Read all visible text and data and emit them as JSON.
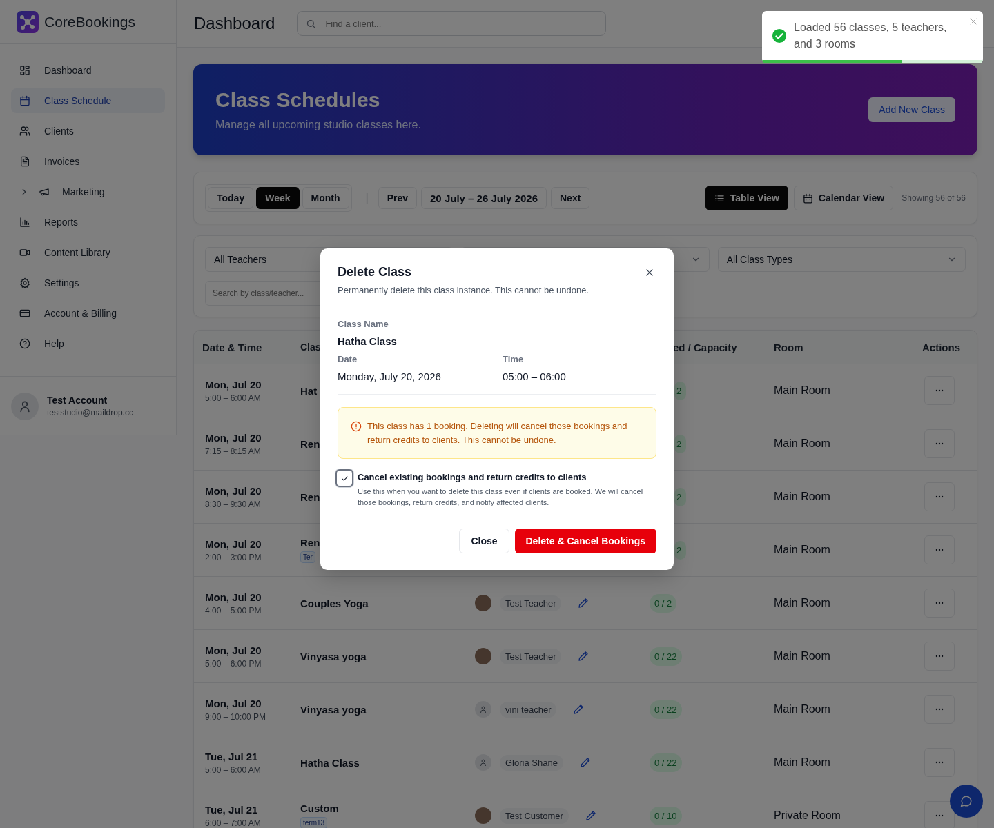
{
  "sidebar": {
    "brand": "CoreBookings",
    "items": [
      {
        "label": "Dashboard",
        "kind": "link",
        "selected": false
      },
      {
        "label": "Class Schedule",
        "kind": "link",
        "selected": true
      },
      {
        "label": "Clients",
        "kind": "link",
        "selected": false
      },
      {
        "label": "Invoices",
        "kind": "link",
        "selected": false
      },
      {
        "label": "Marketing",
        "kind": "group",
        "selected": false,
        "expanded": false
      },
      {
        "label": "Reports",
        "kind": "link",
        "selected": false
      },
      {
        "label": "Content Library",
        "kind": "link",
        "selected": false
      },
      {
        "label": "Settings",
        "kind": "link",
        "selected": false
      },
      {
        "label": "Account & Billing",
        "kind": "link",
        "selected": false
      },
      {
        "label": "Help",
        "kind": "link",
        "selected": false
      }
    ],
    "user": {
      "name": "Test Account",
      "email": "teststudio@maildrop.cc"
    }
  },
  "header": {
    "title": "Dashboard",
    "search": {
      "placeholder": "Find a client..."
    }
  },
  "toast": {
    "message": "Loaded 56 classes, 5 teachers, and 3 rooms",
    "level": 0.63
  },
  "banner": {
    "title": "Class Schedules",
    "subtitle": "Manage all upcoming studio classes here.",
    "button": "Add New Class"
  },
  "toolbar": {
    "ranges": [
      {
        "label": "Today",
        "selected": false
      },
      {
        "label": "Week",
        "selected": true
      },
      {
        "label": "Month",
        "selected": false
      }
    ],
    "separator": "|",
    "prev": "Prev",
    "date_range": "20 July – 26 July 2026",
    "next": "Next",
    "views": [
      {
        "label": "Table View",
        "selected": true
      },
      {
        "label": "Calendar View",
        "selected": false
      }
    ],
    "count": "Showing 56 of 56"
  },
  "filters": {
    "teacher": "All Teachers",
    "class_type": "All Class Types",
    "search": {
      "placeholder": "Search by class/teacher..."
    }
  },
  "table": {
    "columns": [
      "Date & Time",
      "Clas",
      "ed / Capacity",
      "Room",
      "Actions"
    ],
    "rows": [
      {
        "kind": "partial",
        "date": "Mon, Jul 20",
        "time": "5:00 – 6:00 AM",
        "class": "Hat",
        "booked": "2",
        "room": "Main Room"
      },
      {
        "kind": "partial",
        "date": "Mon, Jul 20",
        "time": "7:15 – 8:15 AM",
        "class": "Ren",
        "booked": "2",
        "room": "Main Room"
      },
      {
        "kind": "partial",
        "date": "Mon, Jul 20",
        "time": "8:30 – 9:30 AM",
        "class": "Ren",
        "booked": "2",
        "room": "Main Room"
      },
      {
        "kind": "partial",
        "date": "Mon, Jul 20",
        "time": "2:00 – 3:00 PM",
        "class": "Ren",
        "tag": "Ter",
        "booked": "2",
        "room": "Main Room"
      },
      {
        "kind": "full",
        "date": "Mon, Jul 20",
        "time": "4:00 – 5:00 PM",
        "class": "Couples Yoga",
        "teacher": {
          "name": "Test Teacher",
          "photo": true
        },
        "booked": "0 / 2",
        "room": "Main Room"
      },
      {
        "kind": "full",
        "date": "Mon, Jul 20",
        "time": "5:00 – 6:00 PM",
        "class": "Vinyasa yoga",
        "teacher": {
          "name": "Test Teacher",
          "photo": true
        },
        "booked": "0 / 22",
        "room": "Main Room"
      },
      {
        "kind": "full",
        "date": "Mon, Jul 20",
        "time": "9:00 – 10:00 PM",
        "class": "Vinyasa yoga",
        "teacher": {
          "name": "vini teacher",
          "photo": false
        },
        "booked": "0 / 22",
        "room": "Main Room"
      },
      {
        "kind": "full",
        "date": "Tue, Jul 21",
        "time": "5:00 – 6:00 AM",
        "class": "Hatha Class",
        "teacher": {
          "name": "Gloria Shane",
          "photo": false
        },
        "booked": "0 / 22",
        "room": "Main Room"
      },
      {
        "kind": "full",
        "date": "Tue, Jul 21",
        "time": "6:00 – 7:00 AM",
        "class": "Custom",
        "tag": "term13",
        "teacher": {
          "name": "Test Customer",
          "photo": true
        },
        "booked": "0 / 10",
        "room": "Private Room"
      }
    ]
  },
  "modal": {
    "title": "Delete Class",
    "description": "Permanently delete this class instance. This cannot be undone.",
    "fields": [
      {
        "label": "Class Name",
        "value": "Hatha Class"
      },
      {
        "label": "Date",
        "value": "Monday, July 20, 2026"
      },
      {
        "label": "Time",
        "value": "05:00 – 06:00"
      }
    ],
    "warning": "This class has 1 booking. Deleting will cancel those bookings and return credits to clients. This cannot be undone.",
    "option": {
      "label": "Cancel existing bookings and return credits to clients",
      "help": "Use this when you want to delete this class even if clients are booked. We will cancel those bookings, return credits, and notify affected clients.",
      "checked": true
    },
    "buttons": [
      {
        "label": "Close",
        "kind": "secondary"
      },
      {
        "label": "Delete & Cancel Bookings",
        "kind": "danger"
      }
    ]
  }
}
